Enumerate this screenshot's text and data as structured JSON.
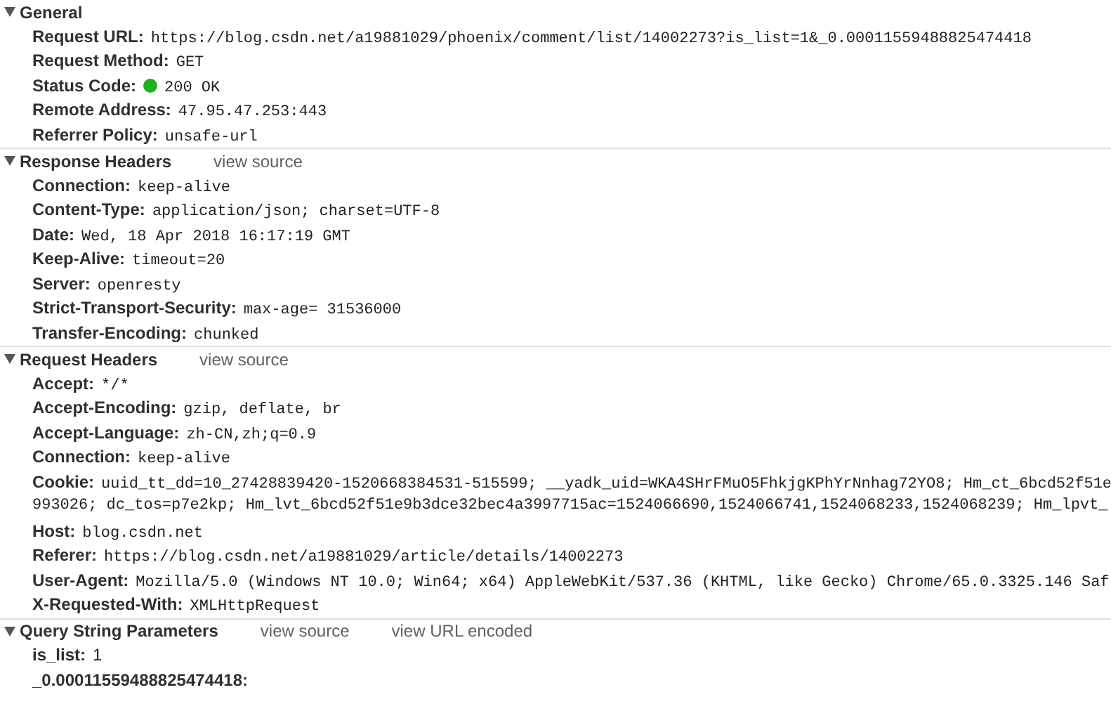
{
  "sections": [
    {
      "title": "General",
      "expanded": true,
      "rows": [
        {
          "kind": "mono",
          "name": "Request URL:",
          "value": "https://blog.csdn.net/a19881029/phoenix/comment/list/14002273?is_list=1&_0.00011559488825474418"
        },
        {
          "kind": "mono",
          "name": "Request Method:",
          "value": "GET"
        },
        {
          "kind": "status",
          "name": "Status Code:",
          "value": "200 OK",
          "color": "#1fb01f"
        },
        {
          "kind": "mono",
          "name": "Remote Address:",
          "value": "47.95.47.253:443"
        },
        {
          "kind": "mono",
          "name": "Referrer Policy:",
          "value": "unsafe-url"
        }
      ]
    },
    {
      "title": "Response Headers",
      "expanded": true,
      "links": [
        "view source"
      ],
      "rows": [
        {
          "kind": "mono",
          "name": "Connection:",
          "value": "keep-alive"
        },
        {
          "kind": "mono",
          "name": "Content-Type:",
          "value": "application/json; charset=UTF-8"
        },
        {
          "kind": "mono",
          "name": "Date:",
          "value": "Wed, 18 Apr 2018 16:17:19 GMT"
        },
        {
          "kind": "mono",
          "name": "Keep-Alive:",
          "value": "timeout=20"
        },
        {
          "kind": "mono",
          "name": "Server:",
          "value": "openresty"
        },
        {
          "kind": "mono",
          "name": "Strict-Transport-Security:",
          "value": "max-age= 31536000"
        },
        {
          "kind": "mono",
          "name": "Transfer-Encoding:",
          "value": "chunked"
        }
      ]
    },
    {
      "title": "Request Headers",
      "expanded": true,
      "links": [
        "view source"
      ],
      "rows": [
        {
          "kind": "mono",
          "name": "Accept:",
          "value": "*/*"
        },
        {
          "kind": "mono",
          "name": "Accept-Encoding:",
          "value": "gzip, deflate, br"
        },
        {
          "kind": "mono",
          "name": "Accept-Language:",
          "value": "zh-CN,zh;q=0.9"
        },
        {
          "kind": "mono",
          "name": "Connection:",
          "value": "keep-alive"
        },
        {
          "kind": "wrapped",
          "name": "Cookie:",
          "value": "uuid_tt_dd=10_27428839420-1520668384531-515599; __yadk_uid=WKA4SHrFMuO5FhkjgKPhYrNnhag72YO8; Hm_ct_6bcd52f51e",
          "continuation": "993026; dc_tos=p7e2kp; Hm_lvt_6bcd52f51e9b3dce32bec4a3997715ac=1524066690,1524066741,1524068233,1524068239; Hm_lpvt_"
        },
        {
          "kind": "mono",
          "name": "Host:",
          "value": "blog.csdn.net"
        },
        {
          "kind": "mono",
          "name": "Referer:",
          "value": "https://blog.csdn.net/a19881029/article/details/14002273"
        },
        {
          "kind": "mono",
          "name": "User-Agent:",
          "value": "Mozilla/5.0 (Windows NT 10.0; Win64; x64) AppleWebKit/537.36 (KHTML, like Gecko) Chrome/65.0.3325.146 Saf"
        },
        {
          "kind": "mono",
          "name": "X-Requested-With:",
          "value": "XMLHttpRequest"
        }
      ]
    },
    {
      "title": "Query String Parameters",
      "expanded": true,
      "links": [
        "view source",
        "view URL encoded"
      ],
      "rows": [
        {
          "kind": "param",
          "name": "is_list:",
          "value": "1"
        },
        {
          "kind": "param",
          "name": "_0.00011559488825474418:"
        }
      ]
    }
  ]
}
